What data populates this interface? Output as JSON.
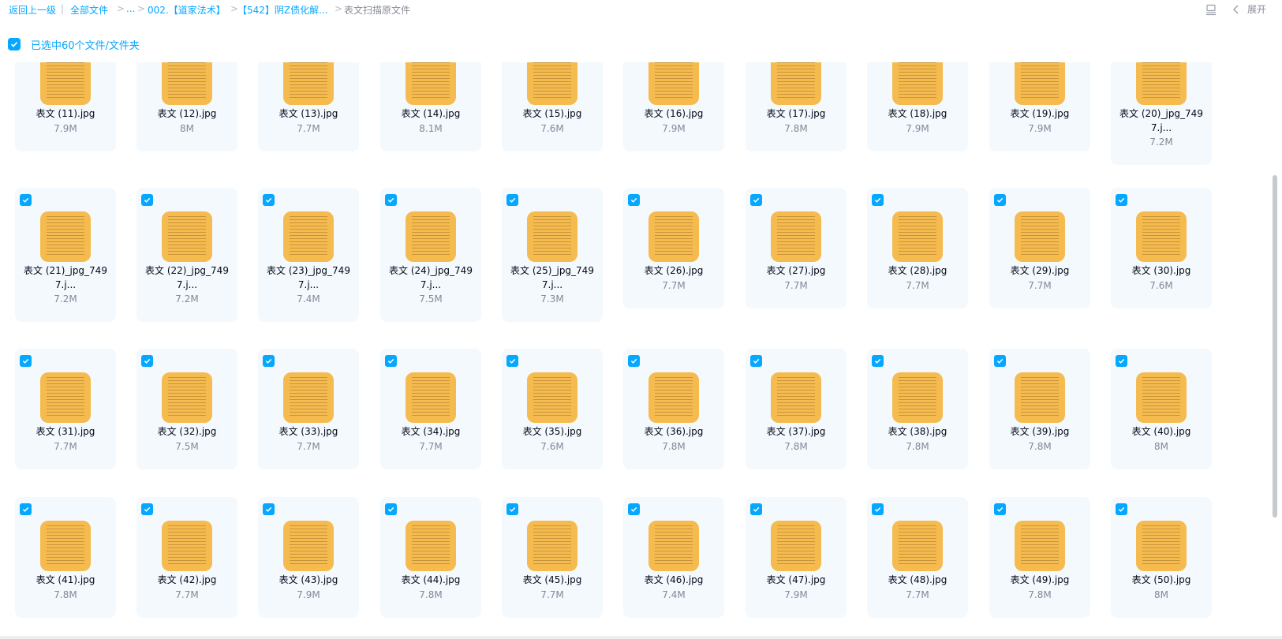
{
  "breadcrumb": {
    "back": "返回上一级",
    "root": "全部文件",
    "ellipsis": "...",
    "level1": "002.【道家法术】",
    "level2": "【542】阴Z债化解...",
    "current": "表文扫描原文件"
  },
  "toolbar": {
    "expand_label": "展开"
  },
  "selection": {
    "label": "已选中60个文件/文件夹"
  },
  "files": [
    {
      "name": "表文 (11).jpg",
      "size": "7.9M",
      "checked": false
    },
    {
      "name": "表文 (12).jpg",
      "size": "8M",
      "checked": false
    },
    {
      "name": "表文 (13).jpg",
      "size": "7.7M",
      "checked": false
    },
    {
      "name": "表文 (14).jpg",
      "size": "8.1M",
      "checked": false
    },
    {
      "name": "表文 (15).jpg",
      "size": "7.6M",
      "checked": false
    },
    {
      "name": "表文 (16).jpg",
      "size": "7.9M",
      "checked": false
    },
    {
      "name": "表文 (17).jpg",
      "size": "7.8M",
      "checked": false
    },
    {
      "name": "表文 (18).jpg",
      "size": "7.9M",
      "checked": false
    },
    {
      "name": "表文 (19).jpg",
      "size": "7.9M",
      "checked": false
    },
    {
      "name": "表文 (20)_jpg_749\n7.j...",
      "size": "7.2M",
      "checked": false
    },
    {
      "name": "表文 (21)_jpg_749\n7.j...",
      "size": "7.2M",
      "checked": true
    },
    {
      "name": "表文 (22)_jpg_749\n7.j...",
      "size": "7.2M",
      "checked": true
    },
    {
      "name": "表文 (23)_jpg_749\n7.j...",
      "size": "7.4M",
      "checked": true
    },
    {
      "name": "表文 (24)_jpg_749\n7.j...",
      "size": "7.5M",
      "checked": true
    },
    {
      "name": "表文 (25)_jpg_749\n7.j...",
      "size": "7.3M",
      "checked": true
    },
    {
      "name": "表文 (26).jpg",
      "size": "7.7M",
      "checked": true
    },
    {
      "name": "表文 (27).jpg",
      "size": "7.7M",
      "checked": true
    },
    {
      "name": "表文 (28).jpg",
      "size": "7.7M",
      "checked": true
    },
    {
      "name": "表文 (29).jpg",
      "size": "7.7M",
      "checked": true
    },
    {
      "name": "表文 (30).jpg",
      "size": "7.6M",
      "checked": true
    },
    {
      "name": "表文 (31).jpg",
      "size": "7.7M",
      "checked": true
    },
    {
      "name": "表文 (32).jpg",
      "size": "7.5M",
      "checked": true
    },
    {
      "name": "表文 (33).jpg",
      "size": "7.7M",
      "checked": true
    },
    {
      "name": "表文 (34).jpg",
      "size": "7.7M",
      "checked": true
    },
    {
      "name": "表文 (35).jpg",
      "size": "7.6M",
      "checked": true
    },
    {
      "name": "表文 (36).jpg",
      "size": "7.8M",
      "checked": true
    },
    {
      "name": "表文 (37).jpg",
      "size": "7.8M",
      "checked": true
    },
    {
      "name": "表文 (38).jpg",
      "size": "7.8M",
      "checked": true
    },
    {
      "name": "表文 (39).jpg",
      "size": "7.8M",
      "checked": true
    },
    {
      "name": "表文 (40).jpg",
      "size": "8M",
      "checked": true
    },
    {
      "name": "表文 (41).jpg",
      "size": "7.8M",
      "checked": true
    },
    {
      "name": "表文 (42).jpg",
      "size": "7.7M",
      "checked": true
    },
    {
      "name": "表文 (43).jpg",
      "size": "7.9M",
      "checked": true
    },
    {
      "name": "表文 (44).jpg",
      "size": "7.8M",
      "checked": true
    },
    {
      "name": "表文 (45).jpg",
      "size": "7.7M",
      "checked": true
    },
    {
      "name": "表文 (46).jpg",
      "size": "7.4M",
      "checked": true
    },
    {
      "name": "表文 (47).jpg",
      "size": "7.9M",
      "checked": true
    },
    {
      "name": "表文 (48).jpg",
      "size": "7.7M",
      "checked": true
    },
    {
      "name": "表文 (49).jpg",
      "size": "7.8M",
      "checked": true
    },
    {
      "name": "表文 (50).jpg",
      "size": "8M",
      "checked": true
    }
  ],
  "colors": {
    "accent": "#06a7ff",
    "thumb": "#f6bb4f",
    "card_bg": "#f3f9fd"
  }
}
